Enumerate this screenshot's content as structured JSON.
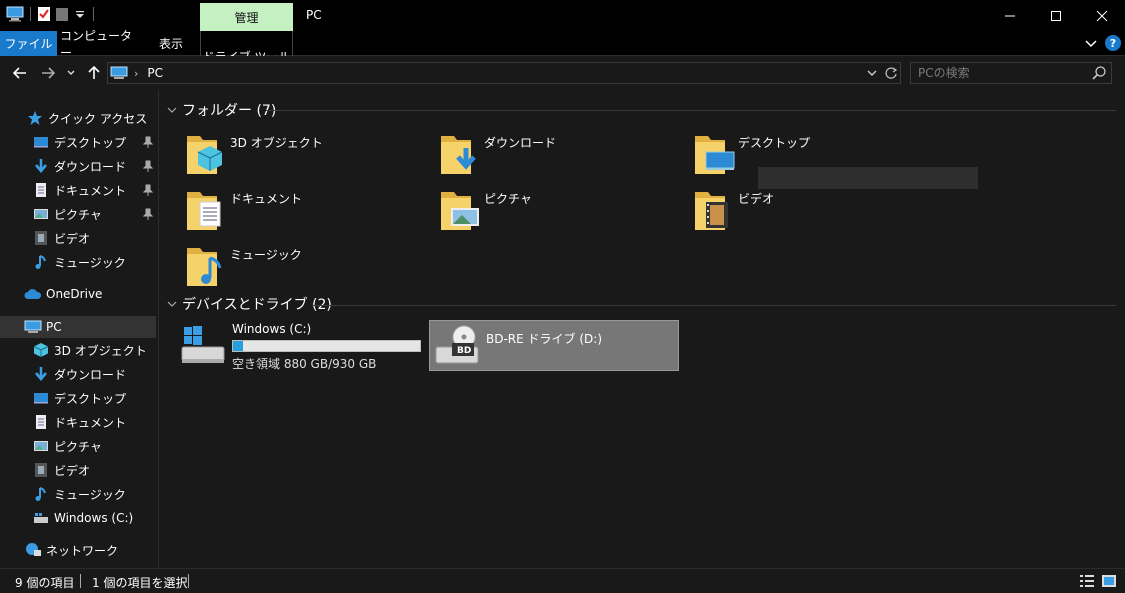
{
  "window": {
    "title": "PC",
    "context_tab": "管理",
    "minimize_icon": "minimize-icon",
    "maximize_icon": "maximize-icon",
    "close_icon": "close-icon"
  },
  "ribbon": {
    "tabs": [
      {
        "label": "ファイル"
      },
      {
        "label": "コンピューター"
      },
      {
        "label": "表示"
      },
      {
        "label": "ドライブ ツール"
      }
    ],
    "help_label": "?",
    "accent": "#1979ca",
    "context_color": "#c4f0c2"
  },
  "address": {
    "crumb": "PC",
    "separator": "›"
  },
  "search": {
    "placeholder": "PCの検索"
  },
  "sidebar": {
    "quick_access": "クイック アクセス",
    "quick_items": [
      {
        "label": "デスクトップ",
        "icon": "desktop-icon",
        "pinned": true
      },
      {
        "label": "ダウンロード",
        "icon": "download-icon",
        "pinned": true
      },
      {
        "label": "ドキュメント",
        "icon": "document-icon",
        "pinned": true
      },
      {
        "label": "ピクチャ",
        "icon": "picture-icon",
        "pinned": true
      },
      {
        "label": "ビデオ",
        "icon": "video-icon",
        "pinned": false
      },
      {
        "label": "ミュージック",
        "icon": "music-icon",
        "pinned": false
      }
    ],
    "onedrive": "OneDrive",
    "pc": "PC",
    "pc_items": [
      {
        "label": "3D オブジェクト",
        "icon": "3d-objects-icon"
      },
      {
        "label": "ダウンロード",
        "icon": "download-icon"
      },
      {
        "label": "デスクトップ",
        "icon": "desktop-icon"
      },
      {
        "label": "ドキュメント",
        "icon": "document-icon"
      },
      {
        "label": "ピクチャ",
        "icon": "picture-icon"
      },
      {
        "label": "ビデオ",
        "icon": "video-icon"
      },
      {
        "label": "ミュージック",
        "icon": "music-icon"
      },
      {
        "label": "Windows (C:)",
        "icon": "drive-icon"
      }
    ],
    "network": "ネットワーク"
  },
  "main": {
    "folders_header": "フォルダー (7)",
    "folders": [
      {
        "label": "3D オブジェクト",
        "icon": "3d-objects-folder-icon"
      },
      {
        "label": "ダウンロード",
        "icon": "download-folder-icon"
      },
      {
        "label": "デスクトップ",
        "icon": "desktop-folder-icon"
      },
      {
        "label": "ドキュメント",
        "icon": "document-folder-icon"
      },
      {
        "label": "ピクチャ",
        "icon": "picture-folder-icon"
      },
      {
        "label": "ビデオ",
        "icon": "video-folder-icon"
      },
      {
        "label": "ミュージック",
        "icon": "music-folder-icon"
      }
    ],
    "drives_header": "デバイスとドライブ (2)",
    "drives": [
      {
        "label": "Windows (C:)",
        "free": "空き領域 880 GB/930 GB",
        "used_fraction": 0.0538
      },
      {
        "label": "BD-RE ドライブ (D:)",
        "badge": "BD"
      }
    ]
  },
  "status": {
    "count": "9 個の項目",
    "selection": "1 個の項目を選択"
  }
}
